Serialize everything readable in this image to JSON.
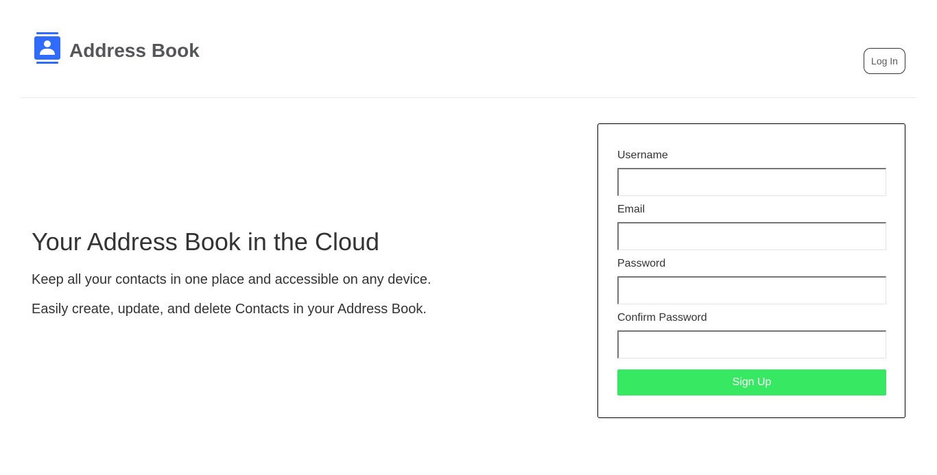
{
  "header": {
    "brand_title": "Address Book",
    "brand_icon": "contact-book-icon",
    "login_label": "Log In"
  },
  "hero": {
    "title": "Your Address Book in the Cloud",
    "line1": "Keep all your contacts in one place and accessible on any device.",
    "line2": "Easily create, update, and delete Contacts in your Address Book."
  },
  "form": {
    "username_label": "Username",
    "username_value": "",
    "email_label": "Email",
    "email_value": "",
    "password_label": "Password",
    "password_value": "",
    "confirm_password_label": "Confirm Password",
    "confirm_password_value": "",
    "signup_label": "Sign Up"
  },
  "colors": {
    "brand_icon": "#2f6bff",
    "brand_text": "#55565a",
    "signup_button": "#37e862"
  }
}
